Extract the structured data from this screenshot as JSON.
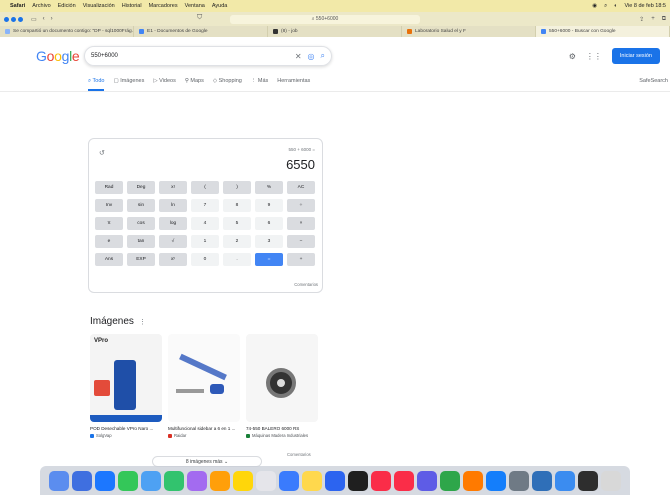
{
  "menubar": {
    "items": [
      "Safari",
      "Archivo",
      "Edición",
      "Visualización",
      "Historial",
      "Marcadores",
      "Ventana",
      "Ayuda"
    ],
    "datetime": "Vie 8 de feb  18:5"
  },
  "toolbar": {
    "address": "550+6000"
  },
  "tabs": [
    {
      "label": "Se compartió un documento contigo: \"DP - sql1000Frág...",
      "color": "#8ab4f8"
    },
    {
      "label": "E1 - Documentos de Google",
      "color": "#4285f4"
    },
    {
      "label": "(8) - job",
      "color": "#333333"
    },
    {
      "label": "Laboratorio Salud el y F",
      "color": "#e8710a"
    },
    {
      "label": "550+6000 - Buscar con Google",
      "color": "#4285f4"
    }
  ],
  "google": {
    "logo": [
      "G",
      "o",
      "o",
      "g",
      "l",
      "e"
    ],
    "query": "550+6000",
    "signin": "Iniciar sesión"
  },
  "search_tabs": [
    "Todo",
    "Imágenes",
    "Videos",
    "Maps",
    "Shopping",
    "Más",
    "Herramientas"
  ],
  "safesearch": "SafeSearch",
  "calculator": {
    "expression": "550 + 6000 =",
    "result": "6550",
    "keys": [
      {
        "label": "Rad",
        "kind": "fn"
      },
      {
        "label": "Deg",
        "kind": "fn"
      },
      {
        "label": "x!",
        "kind": "fn"
      },
      {
        "label": "(",
        "kind": "fn"
      },
      {
        "label": ")",
        "kind": "fn"
      },
      {
        "label": "%",
        "kind": "fn"
      },
      {
        "label": "AC",
        "kind": "fn"
      },
      {
        "label": "Inv",
        "kind": "fn"
      },
      {
        "label": "sin",
        "kind": "fn"
      },
      {
        "label": "ln",
        "kind": "fn"
      },
      {
        "label": "7",
        "kind": "num"
      },
      {
        "label": "8",
        "kind": "num"
      },
      {
        "label": "9",
        "kind": "num"
      },
      {
        "label": "÷",
        "kind": "fn"
      },
      {
        "label": "π",
        "kind": "fn"
      },
      {
        "label": "cos",
        "kind": "fn"
      },
      {
        "label": "log",
        "kind": "fn"
      },
      {
        "label": "4",
        "kind": "num"
      },
      {
        "label": "5",
        "kind": "num"
      },
      {
        "label": "6",
        "kind": "num"
      },
      {
        "label": "×",
        "kind": "fn"
      },
      {
        "label": "e",
        "kind": "fn"
      },
      {
        "label": "tan",
        "kind": "fn"
      },
      {
        "label": "√",
        "kind": "fn"
      },
      {
        "label": "1",
        "kind": "num"
      },
      {
        "label": "2",
        "kind": "num"
      },
      {
        "label": "3",
        "kind": "num"
      },
      {
        "label": "−",
        "kind": "fn"
      },
      {
        "label": "Ans",
        "kind": "fn"
      },
      {
        "label": "EXP",
        "kind": "fn"
      },
      {
        "label": "xʸ",
        "kind": "fn"
      },
      {
        "label": "0",
        "kind": "num"
      },
      {
        "label": ".",
        "kind": "num"
      },
      {
        "label": "=",
        "kind": "eq"
      },
      {
        "label": "+",
        "kind": "fn"
      }
    ],
    "info": "Comentarios"
  },
  "images": {
    "title": "Imágenes",
    "items": [
      {
        "caption": "POD Desechable VPro Naro ...",
        "source": "SolgVap",
        "source_color": "#1a73e8"
      },
      {
        "caption": "Multifuncional sidebar a 6 en 1 ...",
        "source": "Raidar",
        "source_color": "#d93025"
      },
      {
        "caption": "74-550 BALERO 6000 RS",
        "source": "Máquinas Madera Industriales",
        "source_color": "#188038"
      }
    ],
    "info": "Comentarios",
    "more": "8 imágenes más"
  },
  "dock_colors": [
    "#5b8def",
    "#3f6fe0",
    "#1c77ff",
    "#34c759",
    "#4ea1f3",
    "#32c36e",
    "#a36bf0",
    "#ff9f0a",
    "#ffd60a",
    "#e5e5ea",
    "#3a7bfd",
    "#ffd84d",
    "#2c64f0",
    "#1f1f1f",
    "#fa2d48",
    "#fa2d48",
    "#5e5ce6",
    "#2ea64a",
    "#ff7a00",
    "#147efb",
    "#6f7a85",
    "#2f6fb8",
    "#3b8cf0",
    "#2e2e2e",
    "#d8d8d8"
  ],
  "icons": {
    "search": "search-icon",
    "clear": "close-icon",
    "lens": "lens-icon",
    "settings": "gear-icon",
    "apps": "apps-icon",
    "history": "history-icon"
  }
}
